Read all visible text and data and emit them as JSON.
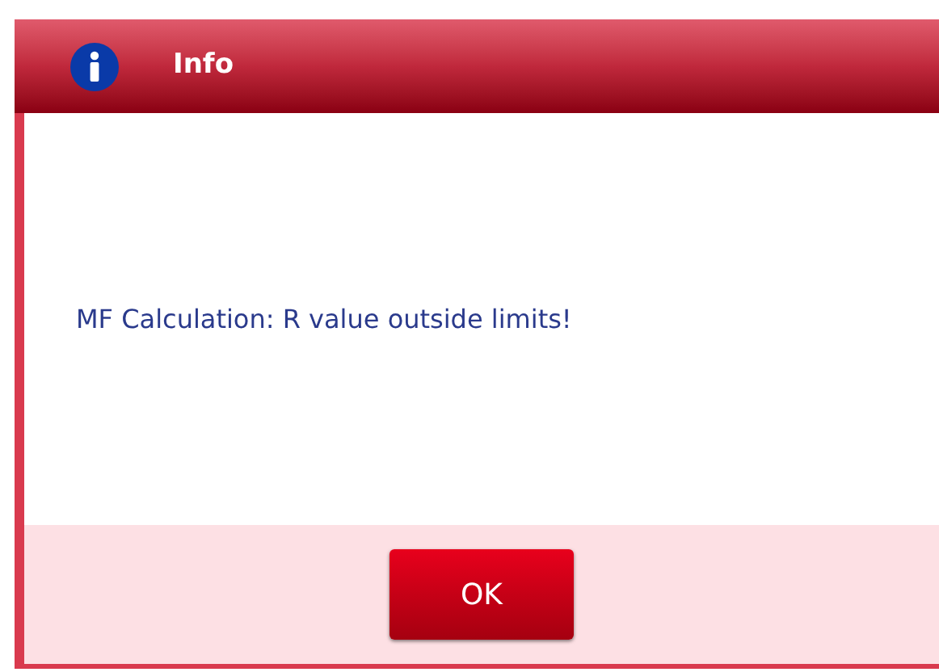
{
  "window": {
    "title": "Info"
  },
  "message": "MF Calculation: R value outside limits!",
  "buttons": [
    "OK"
  ]
}
